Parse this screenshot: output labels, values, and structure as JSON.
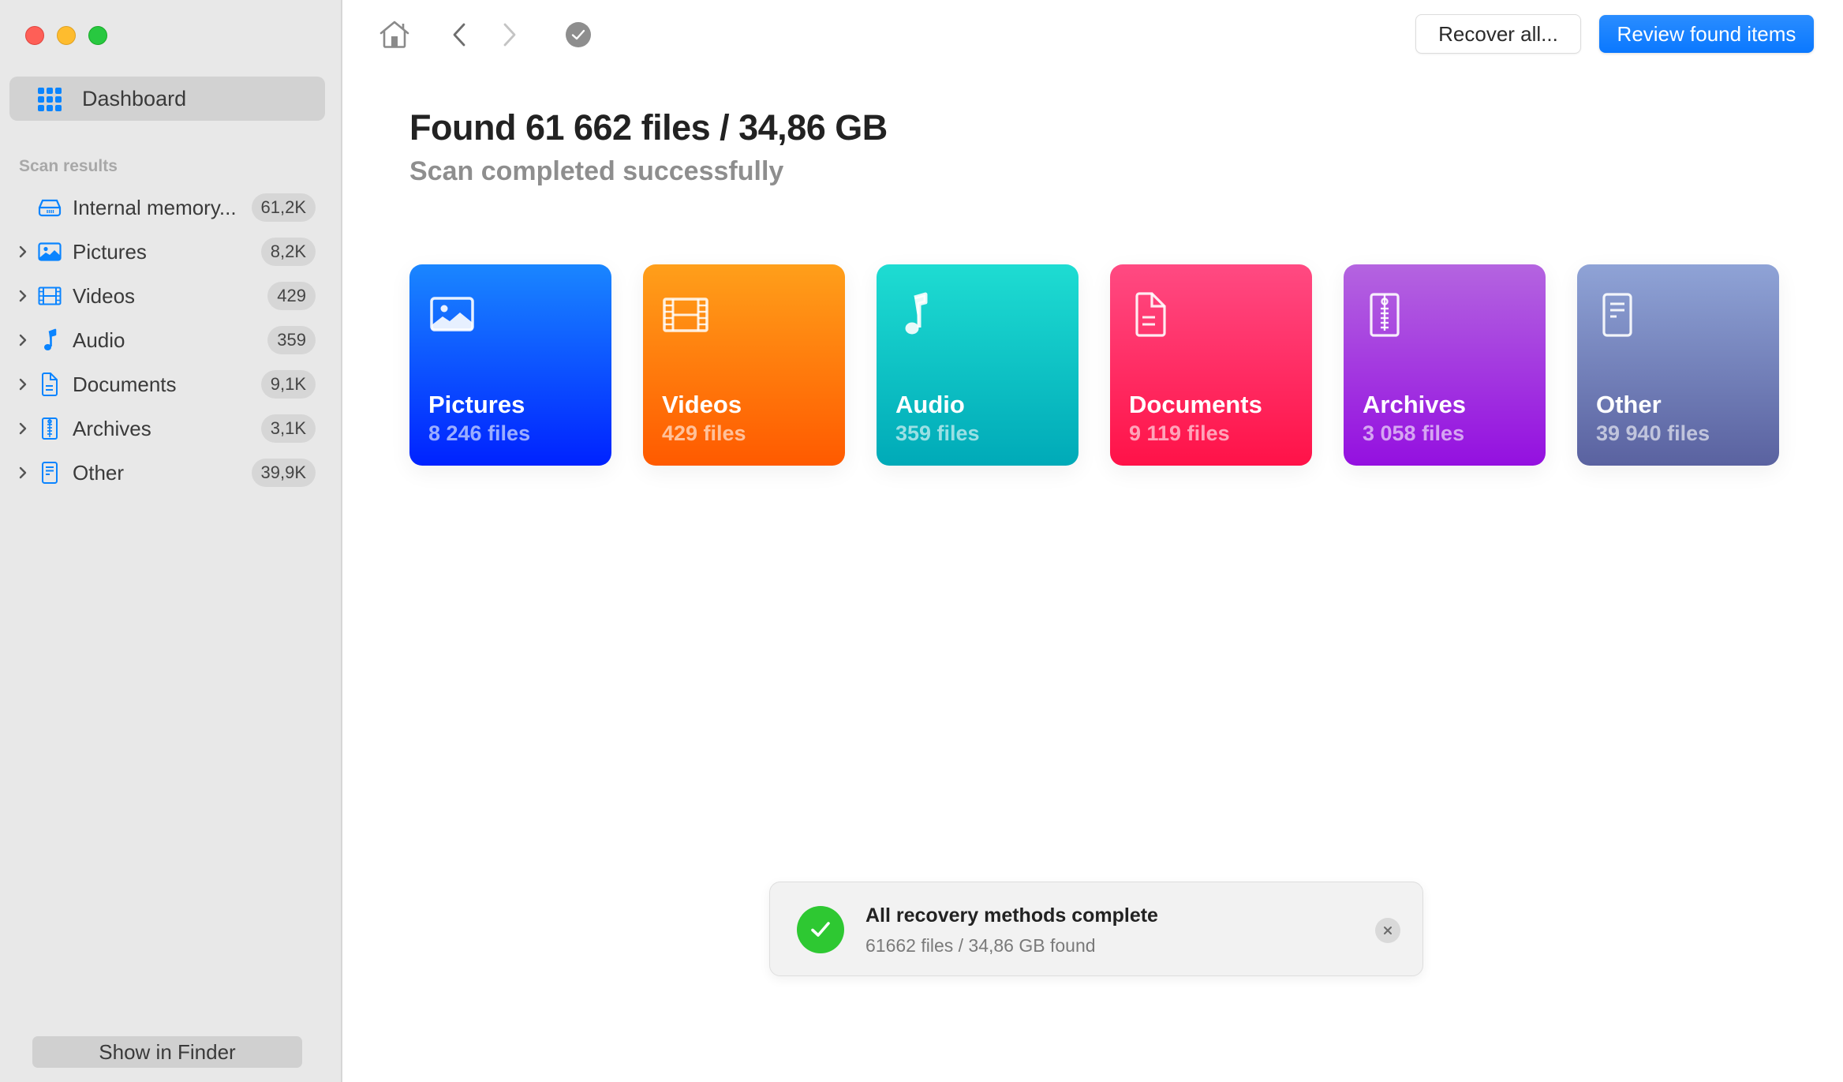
{
  "window": {
    "controls": [
      "close",
      "minimize",
      "zoom"
    ]
  },
  "sidebar": {
    "dashboard": {
      "label": "Dashboard",
      "icon": "grid-icon",
      "selected": true
    },
    "section_header": "Scan results",
    "items": [
      {
        "label": "Internal memory...",
        "count": "61,2K",
        "icon": "drive-icon",
        "expandable": false
      },
      {
        "label": "Pictures",
        "count": "8,2K",
        "icon": "photo-icon",
        "expandable": true
      },
      {
        "label": "Videos",
        "count": "429",
        "icon": "film-icon",
        "expandable": true
      },
      {
        "label": "Audio",
        "count": "359",
        "icon": "music-note-icon",
        "expandable": true
      },
      {
        "label": "Documents",
        "count": "9,1K",
        "icon": "document-icon",
        "expandable": true
      },
      {
        "label": "Archives",
        "count": "3,1K",
        "icon": "archive-icon",
        "expandable": true
      },
      {
        "label": "Other",
        "count": "39,9K",
        "icon": "other-file-icon",
        "expandable": true
      }
    ],
    "show_in_finder": "Show in Finder"
  },
  "toolbar": {
    "recover_all": "Recover all...",
    "review_found": "Review found items"
  },
  "main": {
    "title": "Found 61 662 files / 34,86 GB",
    "subtitle": "Scan completed successfully",
    "cards": [
      {
        "name": "Pictures",
        "count": "8 246 files",
        "icon": "photo-icon",
        "color_top": "#1a86ff",
        "color_bottom": "#0022ff"
      },
      {
        "name": "Videos",
        "count": "429 files",
        "icon": "film-icon",
        "color_top": "#ff9f1a",
        "color_bottom": "#ff5a00"
      },
      {
        "name": "Audio",
        "count": "359 files",
        "icon": "music-note-icon",
        "color_top": "#1edcd2",
        "color_bottom": "#00aab8"
      },
      {
        "name": "Documents",
        "count": "9 119 files",
        "icon": "document-icon",
        "color_top": "#ff4a82",
        "color_bottom": "#ff1248"
      },
      {
        "name": "Archives",
        "count": "3 058 files",
        "icon": "archive-icon",
        "color_top": "#b464e0",
        "color_bottom": "#9410e0"
      },
      {
        "name": "Other",
        "count": "39 940 files",
        "icon": "other-file-icon",
        "color_top": "#8fa3d6",
        "color_bottom": "#5a62a0"
      }
    ]
  },
  "toast": {
    "title": "All recovery methods complete",
    "detail": "61662 files / 34,86 GB found",
    "status_color": "#2ec832"
  }
}
